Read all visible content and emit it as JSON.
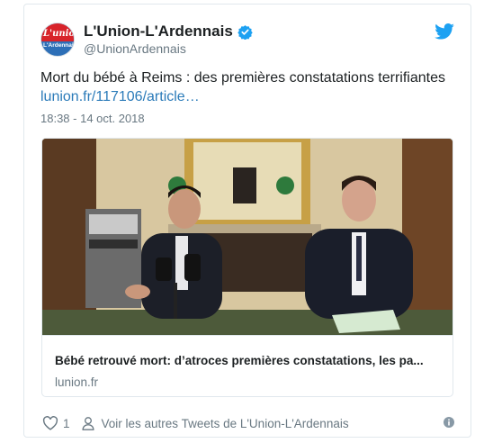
{
  "tweet": {
    "author_name": "L'Union-L'Ardennais",
    "author_handle": "@UnionArdennais",
    "avatar_text_line1": "L'union",
    "avatar_text_line2": "L'Ardennais",
    "text": "Mort du bébé à Reims : des premières constatations terrifiantes",
    "link_text": "lunion.fr/117106/article…",
    "timestamp": "18:38 - 14 oct. 2018"
  },
  "link_card": {
    "title": "Bébé retrouvé mort: d’atroces premières constatations, les pa...",
    "domain": "lunion.fr"
  },
  "footer": {
    "likes_count": "1",
    "see_more": "Voir les autres Tweets de L'Union-L'Ardennais"
  },
  "colors": {
    "link": "#2b7bb9",
    "verified": "#1da1f2",
    "secondary_text": "#697882",
    "border": "#e1e8ed"
  },
  "icons": [
    "verified-badge-icon",
    "twitter-bird-icon",
    "heart-icon",
    "person-icon",
    "info-icon"
  ]
}
